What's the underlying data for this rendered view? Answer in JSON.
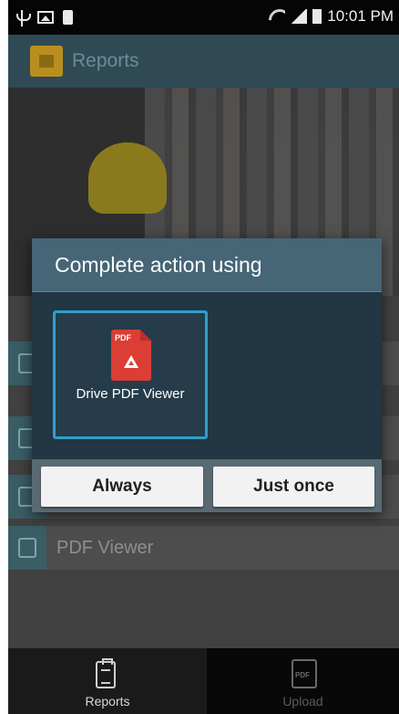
{
  "status_bar": {
    "time": "10:01 PM",
    "left_icons": [
      "usb-icon",
      "gallery-icon",
      "battery-small-icon"
    ],
    "right_icons": [
      "wifi-icon",
      "signal-icon",
      "battery-icon"
    ]
  },
  "app_bar": {
    "title": "Reports",
    "logo_icon": "home-logo-icon"
  },
  "background_list": {
    "items": [
      {
        "label": ""
      },
      {
        "label": ""
      },
      {
        "label": ""
      },
      {
        "label": "PDF Viewer"
      }
    ]
  },
  "dialog": {
    "title": "Complete action using",
    "app_option": {
      "label": "Drive PDF Viewer",
      "icon": "drive-pdf-icon",
      "icon_tag": "PDF",
      "selected": true
    },
    "buttons": {
      "always": "Always",
      "just_once": "Just once"
    },
    "accent_color": "#2f9fcc"
  },
  "bottom_nav": {
    "items": [
      {
        "label": "Reports",
        "icon": "clipboard-icon",
        "active": true
      },
      {
        "label": "Upload",
        "icon": "pdf-file-icon",
        "icon_text": "PDF",
        "active": false
      }
    ]
  }
}
